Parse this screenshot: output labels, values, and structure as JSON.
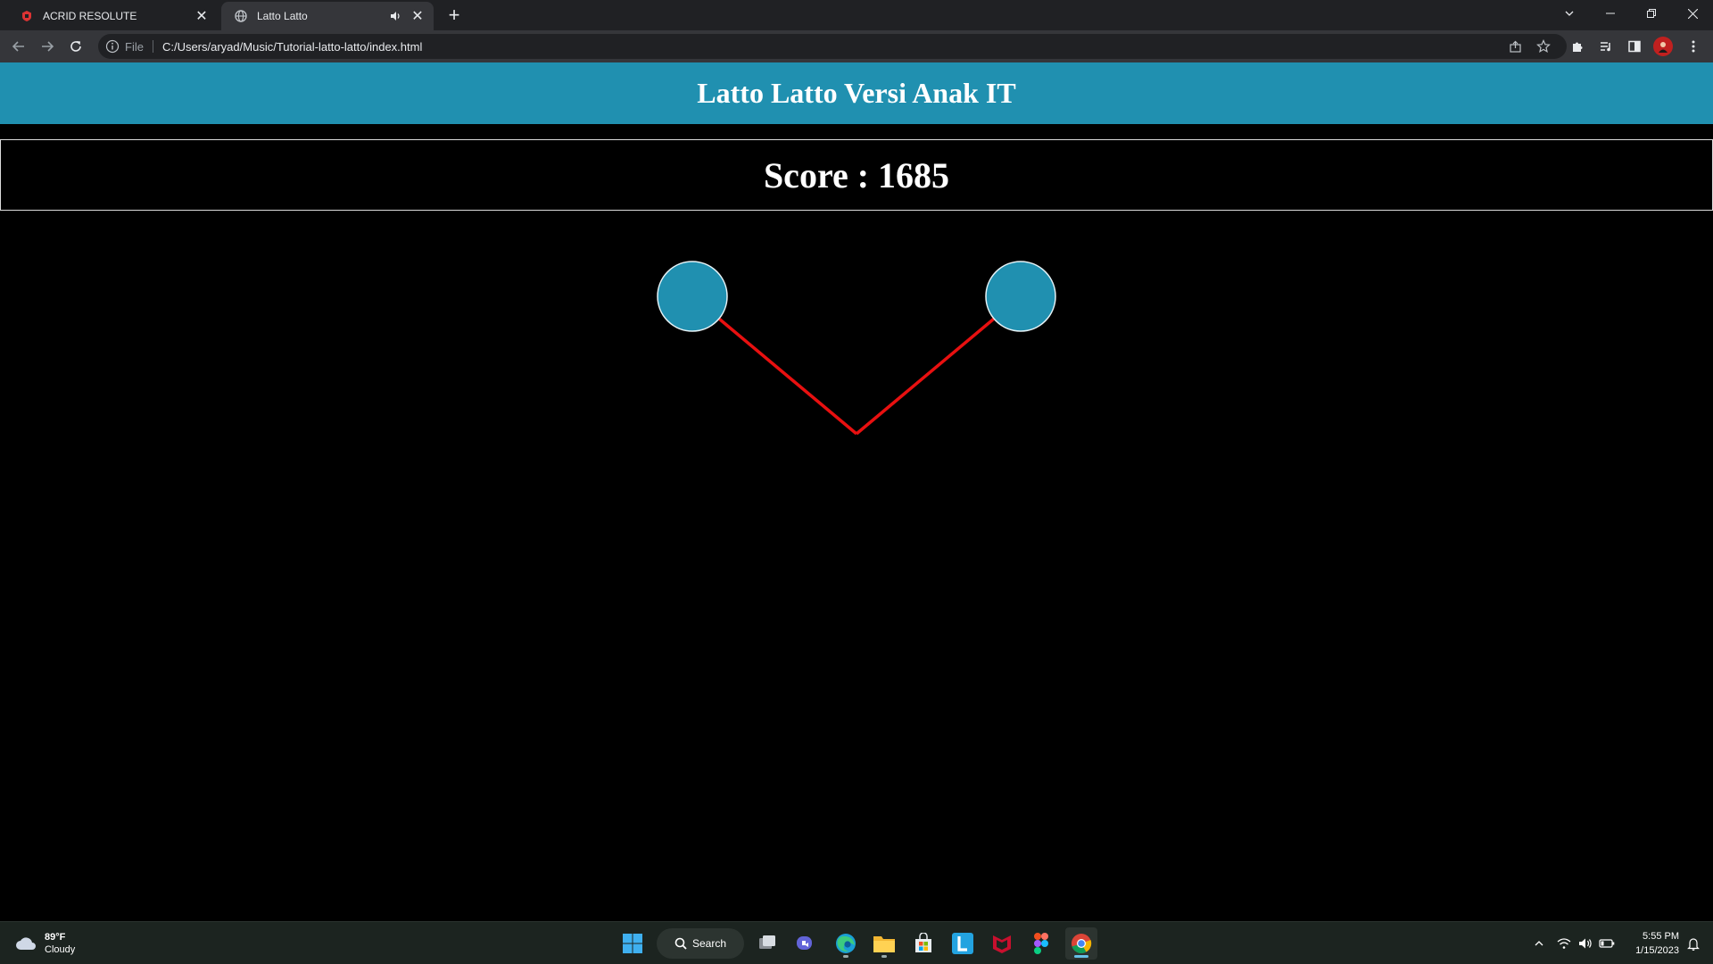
{
  "browser": {
    "tabs": [
      {
        "title": "ACRID RESOLUTE",
        "active": false
      },
      {
        "title": "Latto Latto",
        "active": true
      }
    ],
    "address": {
      "scheme_label": "File",
      "url": "C:/Users/aryad/Music/Tutorial-latto-latto/index.html"
    }
  },
  "page": {
    "header_title": "Latto Latto Versi Anak IT",
    "score_text": "Score : 1685"
  },
  "colors": {
    "header_bg": "#2090b0",
    "ball_fill": "#2090b0",
    "string": "#e81010",
    "page_bg": "#000000"
  },
  "taskbar": {
    "weather_temp": "89°F",
    "weather_desc": "Cloudy",
    "search_label": "Search",
    "time": "5:55 PM",
    "date": "1/15/2023",
    "apps": [
      "windows-start-icon",
      "search-icon",
      "task-view-icon",
      "teams-chat-icon",
      "edge-icon",
      "file-explorer-icon",
      "microsoft-store-icon",
      "l-app-icon",
      "mcafee-icon",
      "figma-icon",
      "chrome-icon"
    ]
  }
}
